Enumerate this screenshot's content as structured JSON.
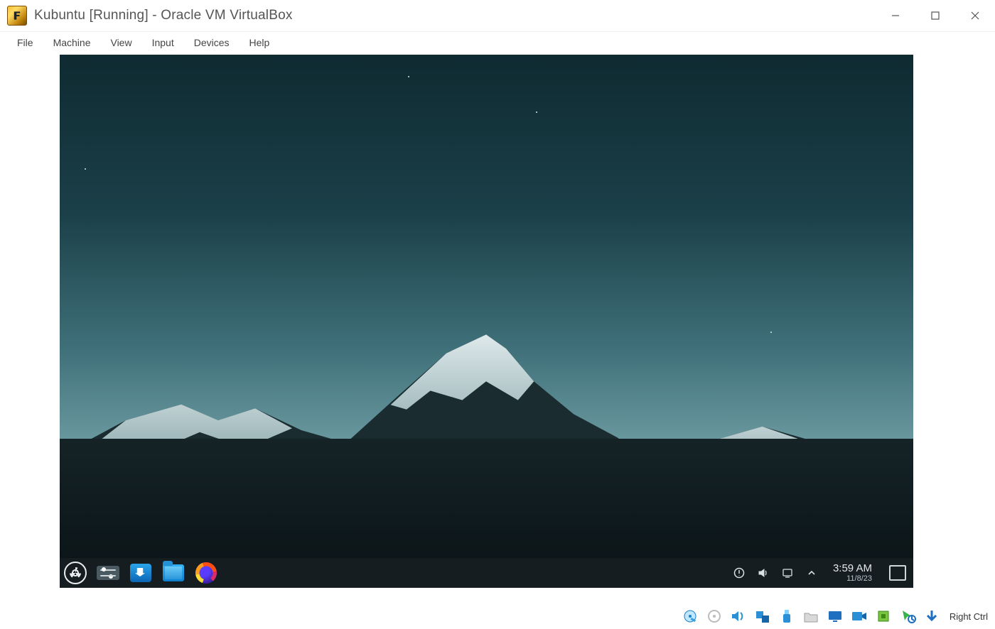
{
  "host": {
    "title": "Kubuntu   [Running] - Oracle VM VirtualBox",
    "menus": [
      "File",
      "Machine",
      "View",
      "Input",
      "Devices",
      "Help"
    ],
    "host_key": "Right Ctrl",
    "status_icons": [
      "hard-disk",
      "optical",
      "network",
      "usb",
      "shared-folder",
      "audio",
      "display",
      "recording",
      "guest-additions",
      "mouse-integration",
      "keyboard-captured"
    ]
  },
  "guest": {
    "taskbar_launchers": [
      {
        "name": "application-launcher",
        "semantic": "kubuntu-logo"
      },
      {
        "name": "system-settings",
        "semantic": "sliders"
      },
      {
        "name": "discover",
        "semantic": "software-store"
      },
      {
        "name": "dolphin",
        "semantic": "file-manager"
      },
      {
        "name": "firefox",
        "semantic": "web-browser"
      }
    ],
    "tray_icons": [
      "updates",
      "volume",
      "network",
      "show-hidden"
    ],
    "clock": {
      "time": "3:59 AM",
      "date": "11/8/23"
    }
  }
}
